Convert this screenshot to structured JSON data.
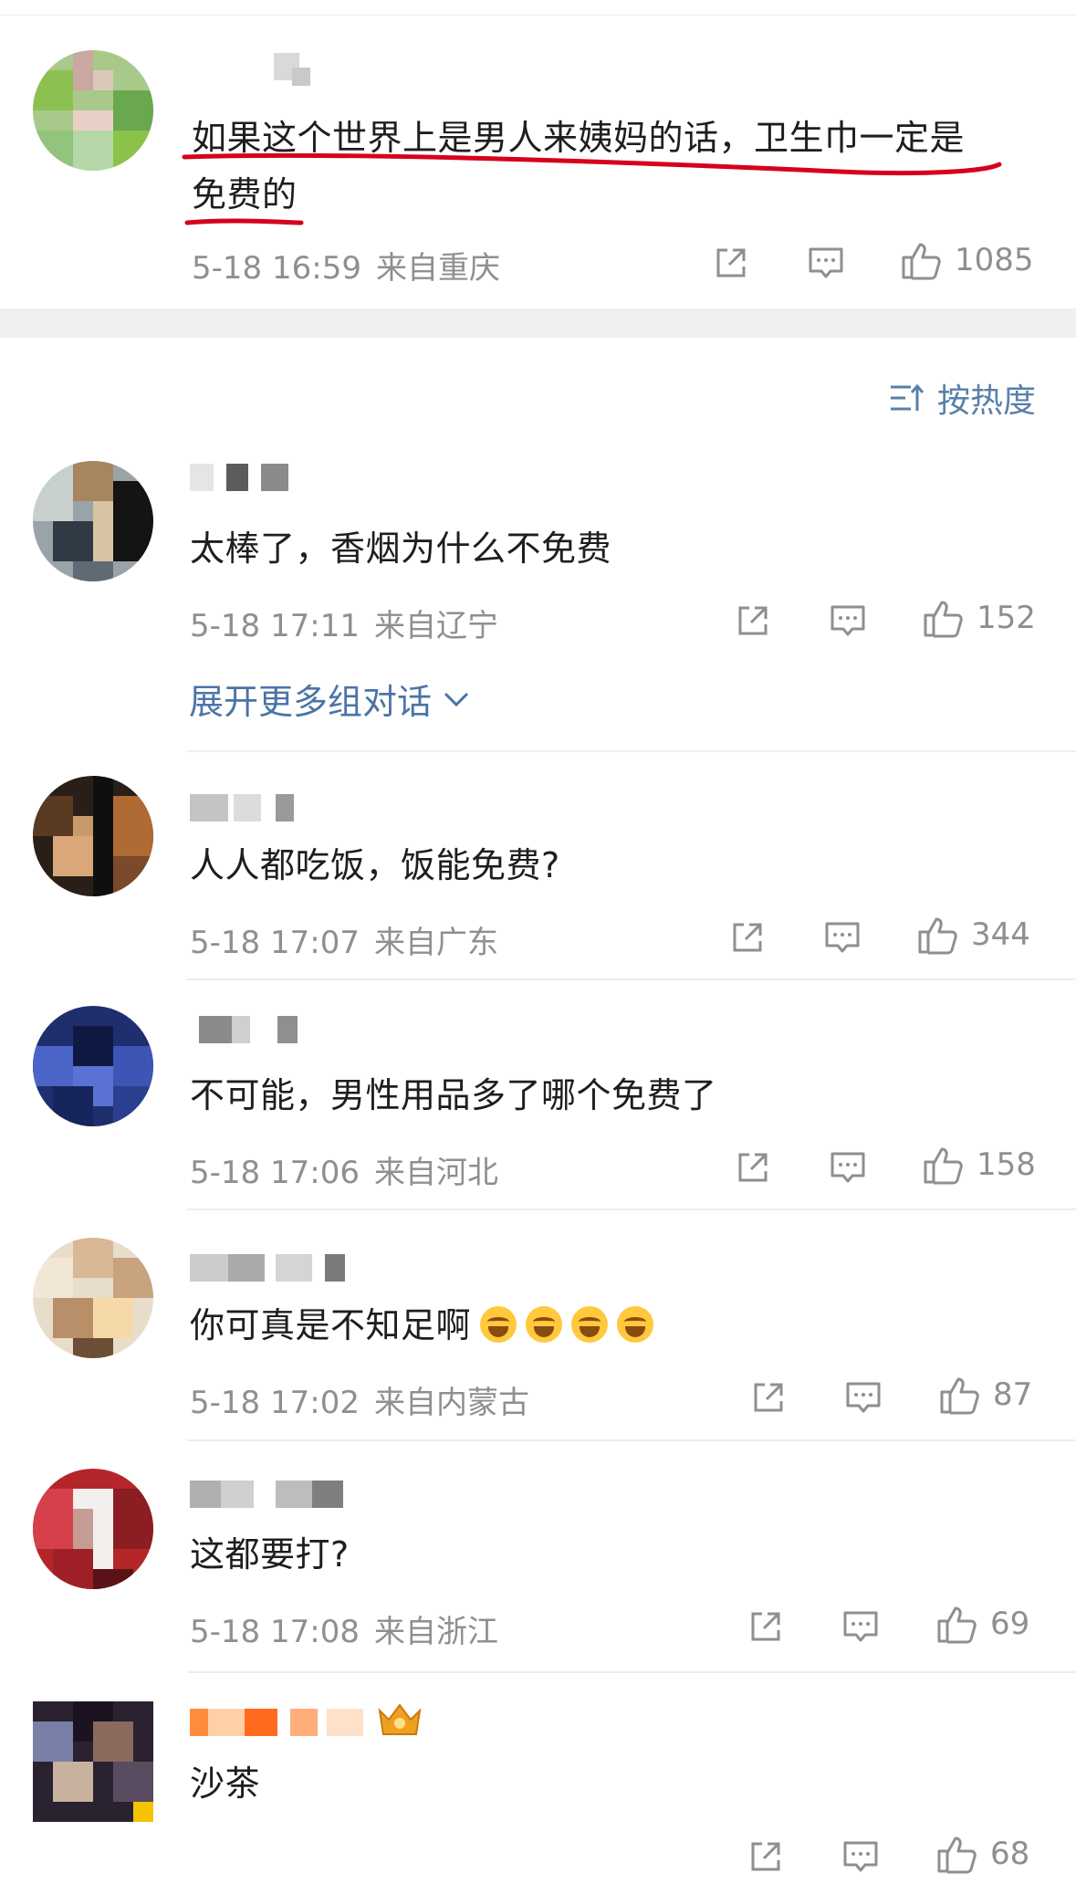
{
  "sort": {
    "label": "按热度",
    "icon": "sort-icon"
  },
  "expand": {
    "label": "展开更多组对话",
    "icon": "chevron-down-icon"
  },
  "comments": [
    {
      "text_line1": "如果这个世界上是男人来姨妈的话，卫生巾一定是",
      "text_line2": "免费的",
      "time": "5-18 16:59",
      "location": "来自重庆",
      "likes": "1085"
    },
    {
      "text": "太棒了，香烟为什么不免费",
      "time": "5-18 17:11",
      "location": "来自辽宁",
      "likes": "152"
    },
    {
      "text": "人人都吃饭，饭能免费?",
      "time": "5-18 17:07",
      "location": "来自广东",
      "likes": "344"
    },
    {
      "text": "不可能，男性用品多了哪个免费了",
      "time": "5-18 17:06",
      "location": "来自河北",
      "likes": "158"
    },
    {
      "text": "你可真是不知足啊",
      "emoji_count": 4,
      "emoji": "laugh-cry-emoji",
      "time": "5-18 17:02",
      "location": "来自内蒙古",
      "likes": "87"
    },
    {
      "text": "这都要打?",
      "time": "5-18 17:08",
      "location": "来自浙江",
      "likes": "69"
    },
    {
      "text": "沙茶",
      "likes": "68"
    }
  ],
  "colors": {
    "accent": "#4b74a6",
    "highlight": "#d6001c",
    "meta": "#8f8f8f"
  }
}
